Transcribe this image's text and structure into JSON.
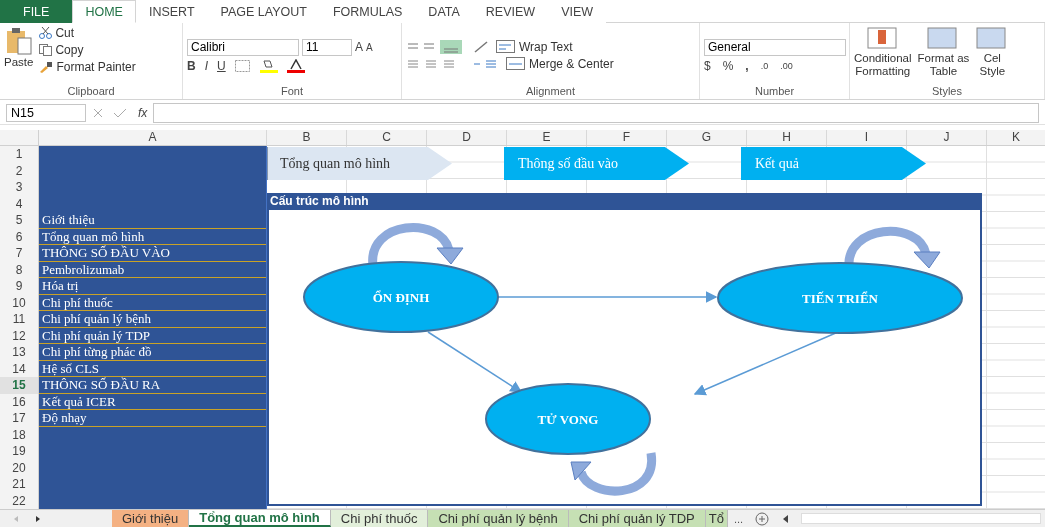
{
  "ribbon_tabs": [
    {
      "label": "FILE",
      "kind": "file",
      "selected": false
    },
    {
      "label": "HOME",
      "kind": "tab",
      "selected": true
    },
    {
      "label": "INSERT",
      "kind": "tab",
      "selected": false
    },
    {
      "label": "PAGE LAYOUT",
      "kind": "tab",
      "selected": false
    },
    {
      "label": "FORMULAS",
      "kind": "tab",
      "selected": false
    },
    {
      "label": "DATA",
      "kind": "tab",
      "selected": false
    },
    {
      "label": "REVIEW",
      "kind": "tab",
      "selected": false
    },
    {
      "label": "VIEW",
      "kind": "tab",
      "selected": false
    }
  ],
  "clipboard": {
    "paste": "Paste",
    "cut": "Cut",
    "copy": "Copy",
    "format_painter": "Format Painter",
    "label": "Clipboard"
  },
  "font": {
    "name": "Calibri",
    "size": "11",
    "grow": "A",
    "shrink": "A",
    "bold": "B",
    "italic": "I",
    "underline": "U",
    "label": "Font"
  },
  "alignment": {
    "wrap_text": "Wrap Text",
    "merge_center": "Merge & Center",
    "label": "Alignment"
  },
  "number": {
    "format": "General",
    "currency": "$",
    "percent": "%",
    "comma": ",",
    "decimals": [
      ".0",
      ".00"
    ],
    "label": "Number"
  },
  "styles": {
    "conditional": [
      "Conditional",
      "Formatting"
    ],
    "format_table": [
      "Format as",
      "Table"
    ],
    "cell_styles": [
      "Cel",
      "Style"
    ],
    "label": "Styles"
  },
  "formula_bar": {
    "name_box": "N15",
    "fx": "fx"
  },
  "column_headers": [
    "A",
    "B",
    "C",
    "D",
    "E",
    "F",
    "G",
    "H",
    "I",
    "J",
    "K"
  ],
  "row_headers": [
    {
      "label": "1",
      "selected": false
    },
    {
      "label": "2",
      "selected": false
    },
    {
      "label": "3",
      "selected": false
    },
    {
      "label": "4",
      "selected": false
    },
    {
      "label": "5",
      "selected": false
    },
    {
      "label": "6",
      "selected": false
    },
    {
      "label": "7",
      "selected": false
    },
    {
      "label": "8",
      "selected": false
    },
    {
      "label": "9",
      "selected": false
    },
    {
      "label": "10",
      "selected": false
    },
    {
      "label": "11",
      "selected": false
    },
    {
      "label": "12",
      "selected": false
    },
    {
      "label": "13",
      "selected": false
    },
    {
      "label": "14",
      "selected": false
    },
    {
      "label": "15",
      "selected": true
    },
    {
      "label": "16",
      "selected": false
    },
    {
      "label": "17",
      "selected": false
    },
    {
      "label": "18",
      "selected": false
    },
    {
      "label": "19",
      "selected": false
    },
    {
      "label": "20",
      "selected": false
    },
    {
      "label": "21",
      "selected": false
    },
    {
      "label": "22",
      "selected": false
    }
  ],
  "menu_items": [
    "Giới thiệu",
    "Tổng quan mô hình",
    "THÔNG SỐ ĐẦU VÀO",
    "Pembrolizumab",
    "Hóa trị",
    "Chi phí thuốc",
    "Chi phí quản lý bệnh",
    "Chi phí quản lý TDP",
    "Chi phí từng phác đồ",
    "Hệ số CLS",
    "THÔNG SỐ ĐẦU RA",
    "Kết quả ICER",
    "Độ nhạy"
  ],
  "nav_buttons": [
    {
      "label": "Tổng quan mô hình",
      "selected": true
    },
    {
      "label": "Thông số đầu vào",
      "selected": false
    },
    {
      "label": "Kết quả",
      "selected": false
    }
  ],
  "diagram": {
    "title": "Cấu trúc mô hình",
    "nodes": [
      "ỔN ĐỊNH",
      "TIẾN TRIỂN",
      "TỬ VONG"
    ]
  },
  "sheet_tabs": [
    {
      "label": "Giới thiệu",
      "color": "#f4b183",
      "selected": false
    },
    {
      "label": "Tổng quan mô hình",
      "color": "#ffffff",
      "selected": true
    },
    {
      "label": "Chi phí thuốc",
      "color": "#e2efda",
      "selected": false
    },
    {
      "label": "Chi phí quản lý bệnh",
      "color": "#c6e0b4",
      "selected": false
    },
    {
      "label": "Chi phí quản lý TDP",
      "color": "#c6e0b4",
      "selected": false
    },
    {
      "label": "Tổ",
      "color": "#c6e0b4",
      "selected": false
    }
  ],
  "more_tabs": "..."
}
